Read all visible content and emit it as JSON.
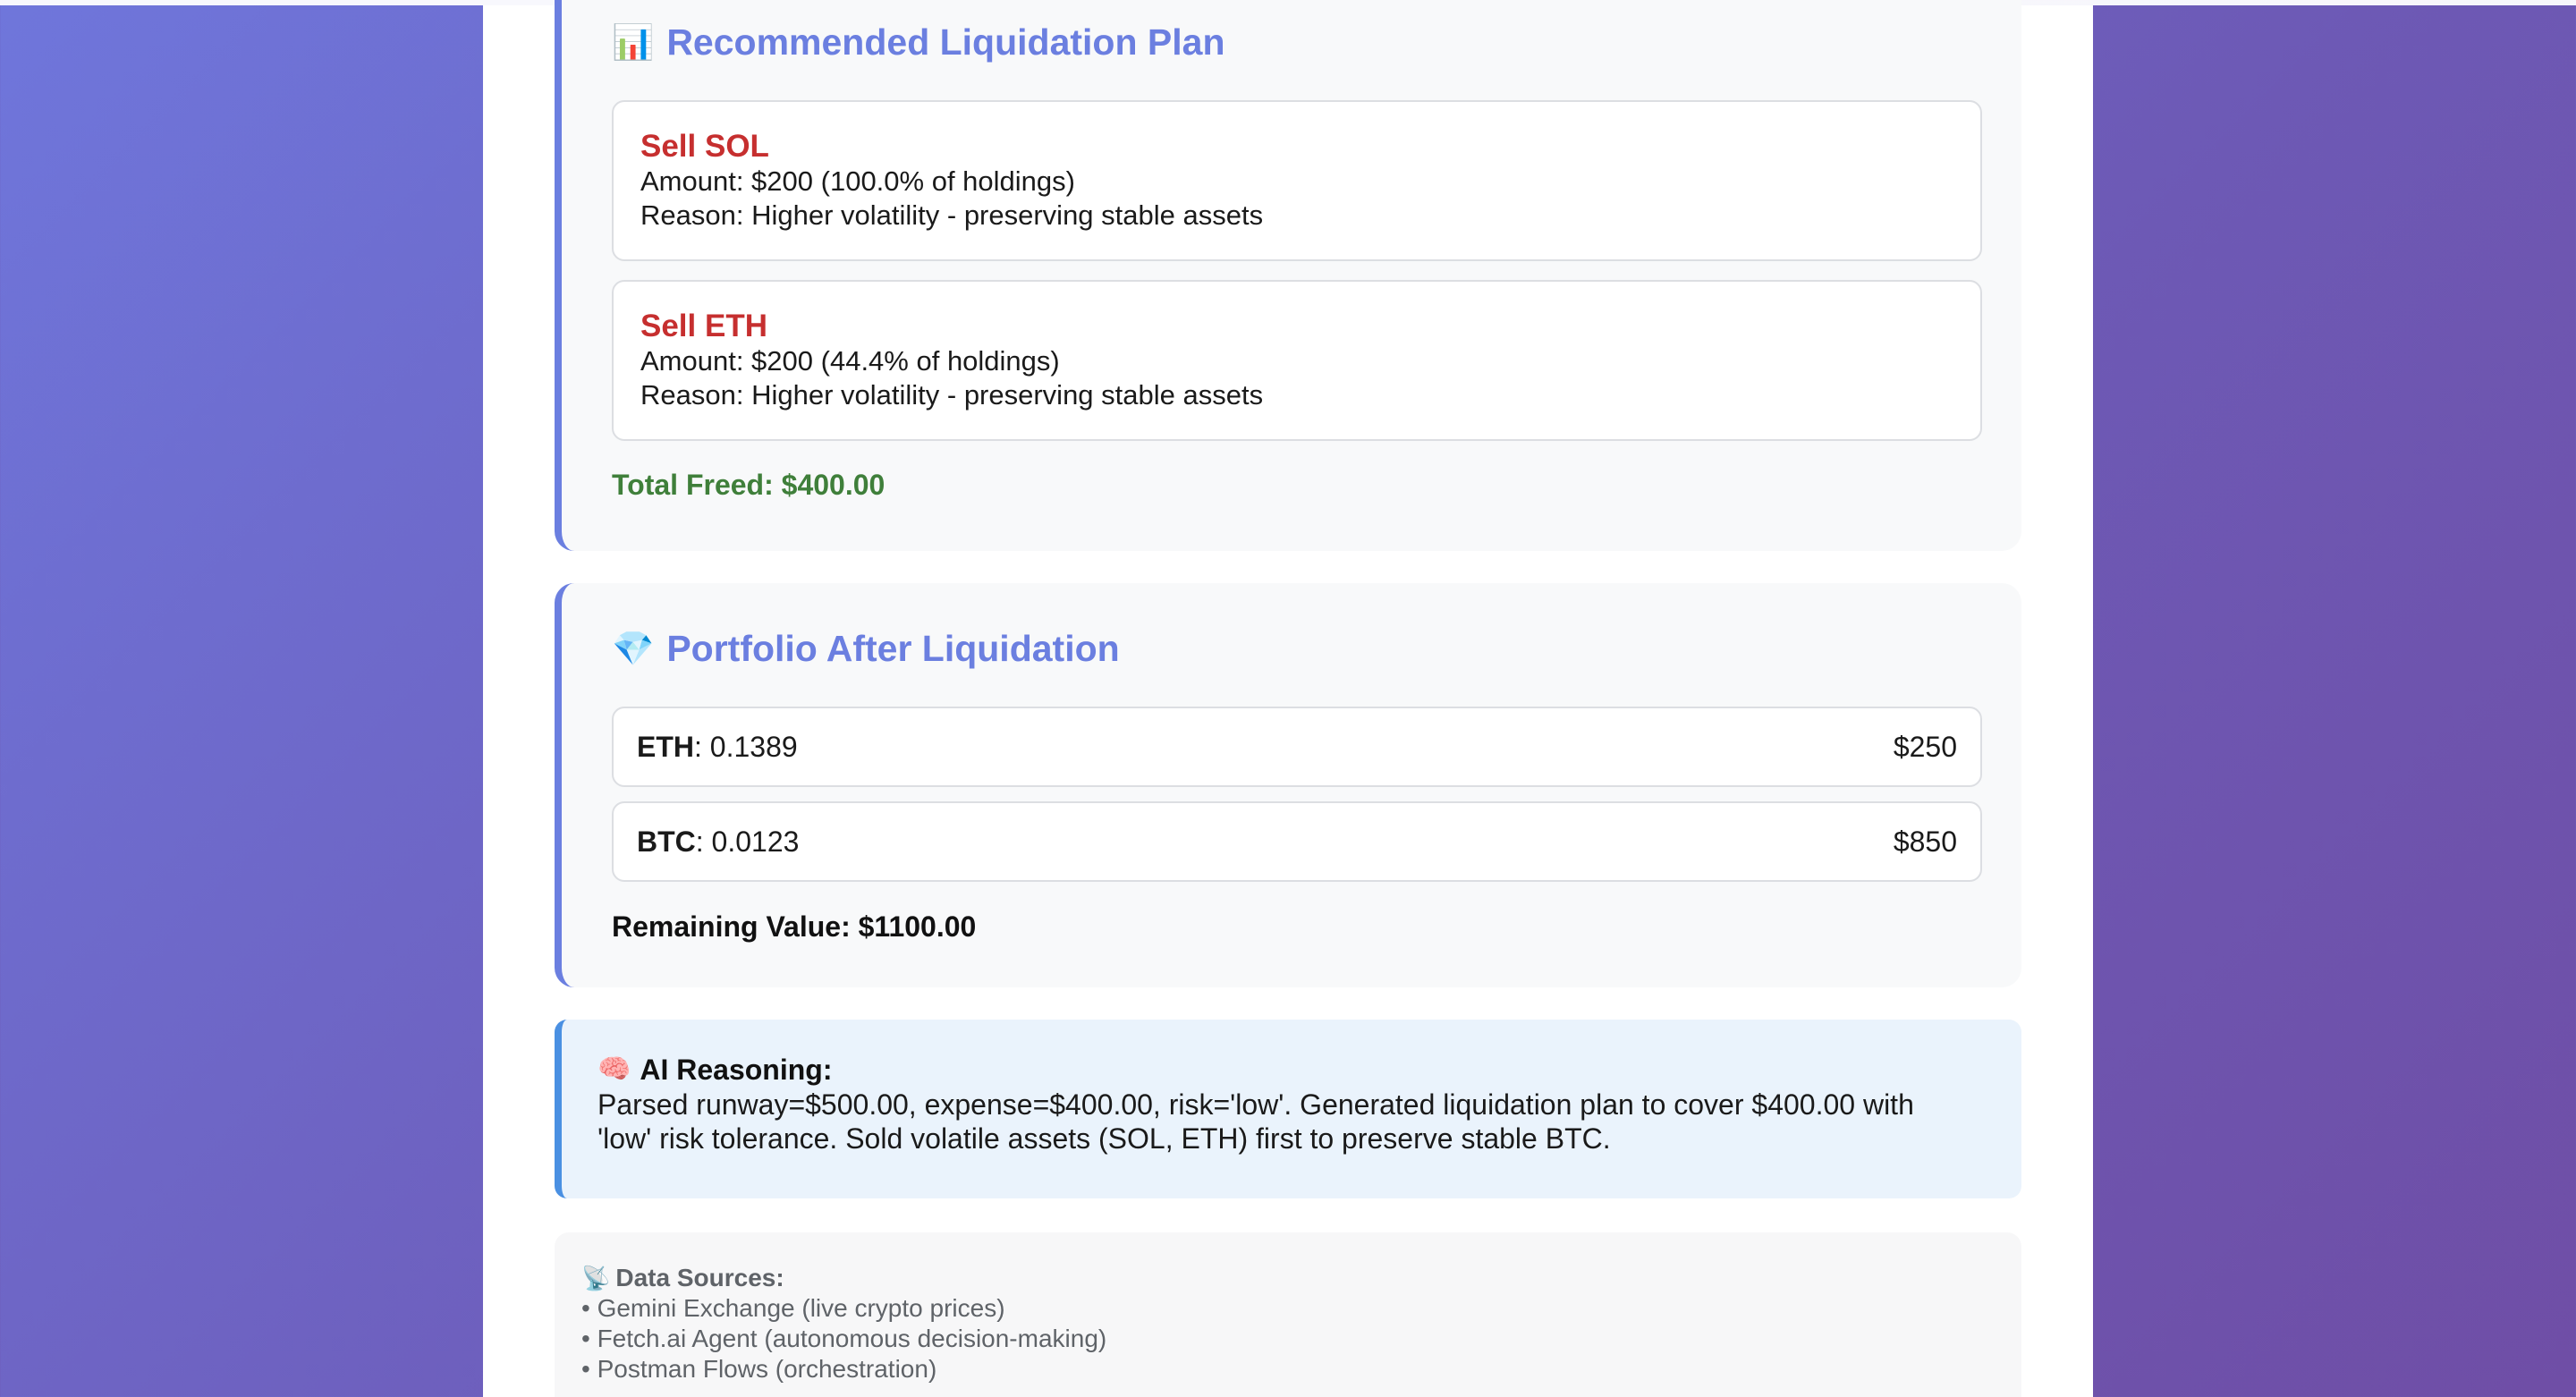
{
  "liquidation_plan": {
    "icon": "bar-chart-icon",
    "title_icon_glyph": "📊",
    "title": "Recommended Liquidation Plan",
    "sells": [
      {
        "title": "Sell SOL",
        "amount": "Amount: $200 (100.0% of holdings)",
        "reason": "Reason: Higher volatility - preserving stable assets"
      },
      {
        "title": "Sell ETH",
        "amount": "Amount: $200 (44.4% of holdings)",
        "reason": "Reason: Higher volatility - preserving stable assets"
      }
    ],
    "total_freed": "Total Freed: $400.00"
  },
  "portfolio_after": {
    "icon": "gem-icon",
    "title_icon_glyph": "💎",
    "title": "Portfolio After Liquidation",
    "holdings": [
      {
        "asset": "ETH",
        "quantity": ": 0.1389",
        "value": "$250"
      },
      {
        "asset": "BTC",
        "quantity": ": 0.0123",
        "value": "$850"
      }
    ],
    "remaining_value": "Remaining Value: $1100.00"
  },
  "ai_reasoning": {
    "icon": "brain-icon",
    "icon_glyph": "🧠",
    "heading": "AI Reasoning:",
    "line1": "Parsed runway=$500.00, expense=$400.00, risk='low'. Generated liquidation plan to cover $400.00 with",
    "line2": "'low' risk tolerance. Sold volatile assets (SOL, ETH) first to preserve stable BTC."
  },
  "data_sources": {
    "icon": "satellite-dish-icon",
    "icon_glyph": "📡",
    "heading": "Data Sources:",
    "items": [
      "• Gemini Exchange (live crypto prices)",
      "• Fetch.ai Agent (autonomous decision-making)",
      "• Postman Flows (orchestration)"
    ]
  },
  "colors": {
    "accent": "#6b7fe0",
    "sell_red": "#c62f2f",
    "freed_green": "#3f7f3a",
    "ai_blue": "#4a90e2"
  }
}
